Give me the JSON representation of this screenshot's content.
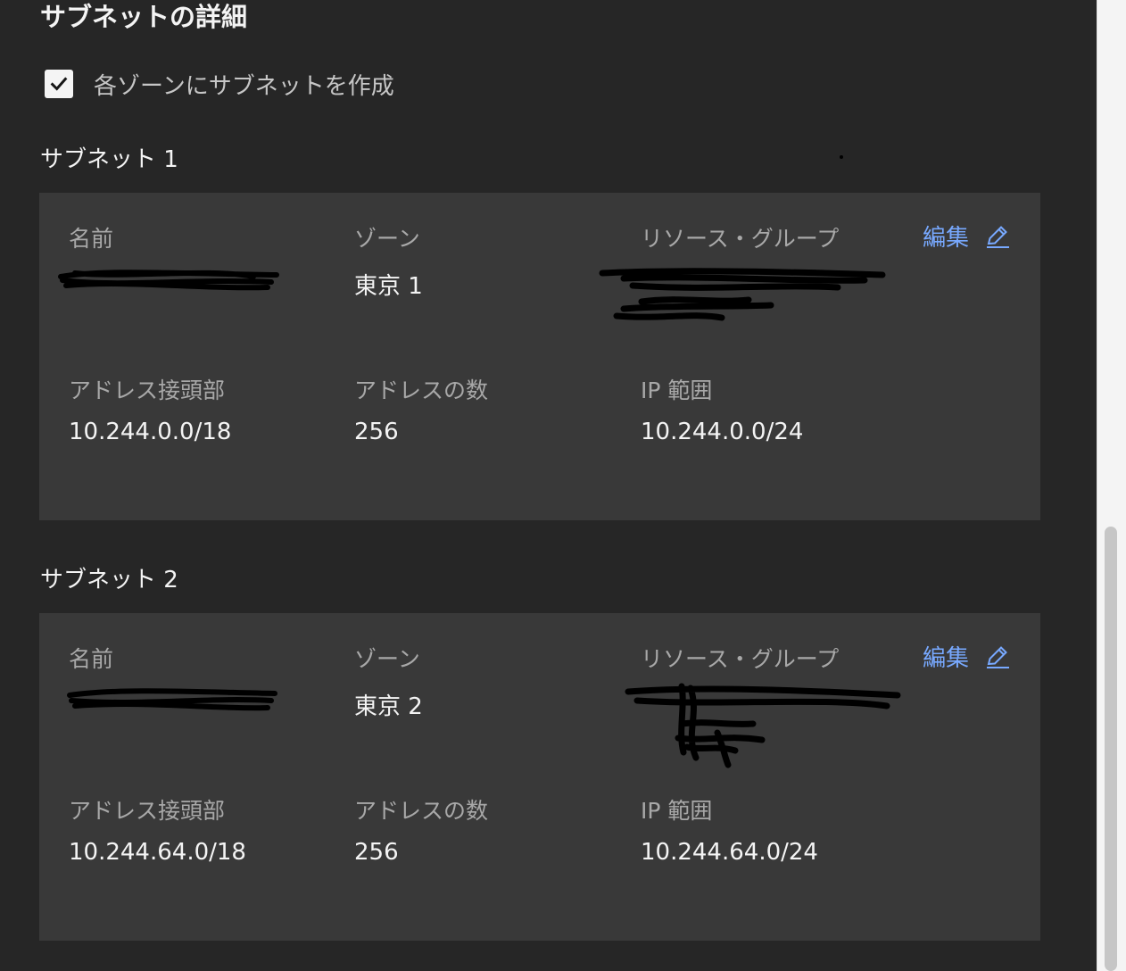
{
  "page": {
    "title": "サブネットの詳細"
  },
  "checkbox": {
    "label": "各ゾーンにサブネットを作成",
    "checked": true
  },
  "subnets": [
    {
      "heading": "サブネット 1",
      "labels": {
        "name": "名前",
        "zone": "ゾーン",
        "resource_group": "リソース・グループ",
        "address_prefix": "アドレス接頭部",
        "address_count": "アドレスの数",
        "ip_range": "IP 範囲"
      },
      "edit_label": "編集",
      "zone": "東京 1",
      "address_prefix": "10.244.0.0/18",
      "address_count": "256",
      "ip_range": "10.244.0.0/24"
    },
    {
      "heading": "サブネット 2",
      "labels": {
        "name": "名前",
        "zone": "ゾーン",
        "resource_group": "リソース・グループ",
        "address_prefix": "アドレス接頭部",
        "address_count": "アドレスの数",
        "ip_range": "IP 範囲"
      },
      "edit_label": "編集",
      "zone": "東京 2",
      "address_prefix": "10.244.64.0/18",
      "address_count": "256",
      "ip_range": "10.244.64.0/24"
    }
  ],
  "colors": {
    "background": "#262626",
    "card": "#393939",
    "link": "#78a9ff",
    "label": "#a8a8a8",
    "value": "#f4f4f4"
  },
  "icons": {
    "checkbox": "checkmark-icon",
    "edit": "pencil-icon"
  }
}
